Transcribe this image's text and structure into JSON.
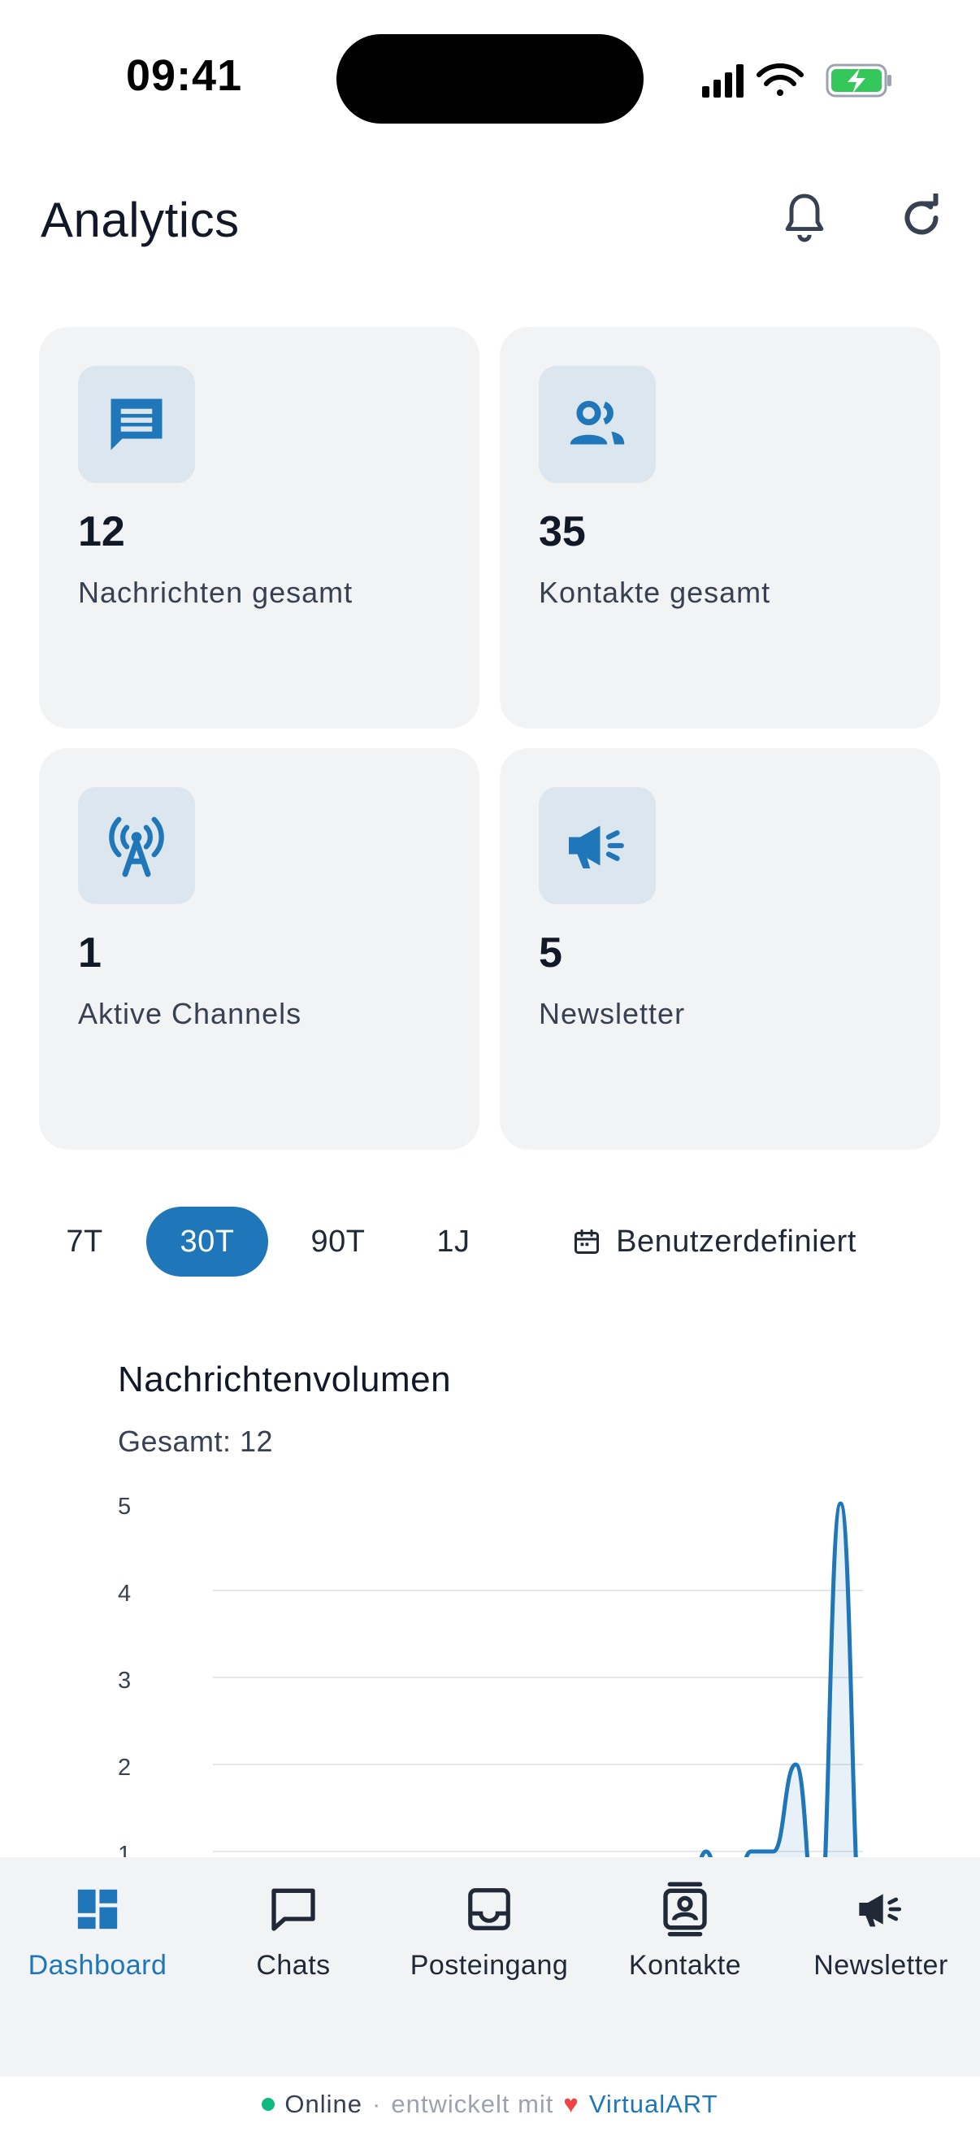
{
  "status_bar": {
    "time": "09:41"
  },
  "header": {
    "title": "Analytics",
    "notifications_icon": "bell-icon",
    "refresh_icon": "refresh-icon"
  },
  "stats": [
    {
      "value": "12",
      "label": "Nachrichten gesamt",
      "icon": "message-icon"
    },
    {
      "value": "35",
      "label": "Kontakte gesamt",
      "icon": "users-icon"
    },
    {
      "value": "1",
      "label": "Aktive Channels",
      "icon": "antenna-icon"
    },
    {
      "value": "5",
      "label": "Newsletter",
      "icon": "megaphone-icon"
    }
  ],
  "ranges": {
    "options": [
      "7T",
      "30T",
      "90T",
      "1J"
    ],
    "selected": "30T",
    "custom_label": "Benutzerdefiniert"
  },
  "chart": {
    "title": "Nachrichtenvolumen",
    "subtitle": "Gesamt: 12"
  },
  "chart_data": {
    "type": "area",
    "title": "Nachrichtenvolumen",
    "subtitle": "Gesamt: 12",
    "y_ticks": [
      "5",
      "4",
      "3",
      "2",
      "1"
    ],
    "ylim": [
      0,
      5
    ],
    "grid": true,
    "series": [
      {
        "values": [
          0,
          0,
          0,
          0,
          0,
          0,
          0,
          0,
          0,
          0,
          0,
          0,
          0,
          0,
          0,
          0,
          0,
          0,
          0,
          0,
          0,
          0,
          1,
          0,
          1,
          1,
          2,
          0,
          5,
          0
        ]
      }
    ],
    "color": "#1f76b9"
  },
  "bottom_nav": [
    {
      "label": "Dashboard",
      "icon": "dashboard-icon",
      "active": true
    },
    {
      "label": "Chats",
      "icon": "chat-icon",
      "active": false
    },
    {
      "label": "Posteingang",
      "icon": "inbox-icon",
      "active": false
    },
    {
      "label": "Kontakte",
      "icon": "contacts-icon",
      "active": false
    },
    {
      "label": "Newsletter",
      "icon": "megaphone-icon",
      "active": false
    }
  ],
  "footer": {
    "status": "Online",
    "separator": "·",
    "dev_text": "entwickelt mit",
    "brand": "VirtualART"
  },
  "colors": {
    "accent": "#1f76b9",
    "card_bg": "#f2f3f5",
    "icon_bg": "#dbe6ef",
    "online": "#10b981",
    "heart": "#ef4444"
  }
}
